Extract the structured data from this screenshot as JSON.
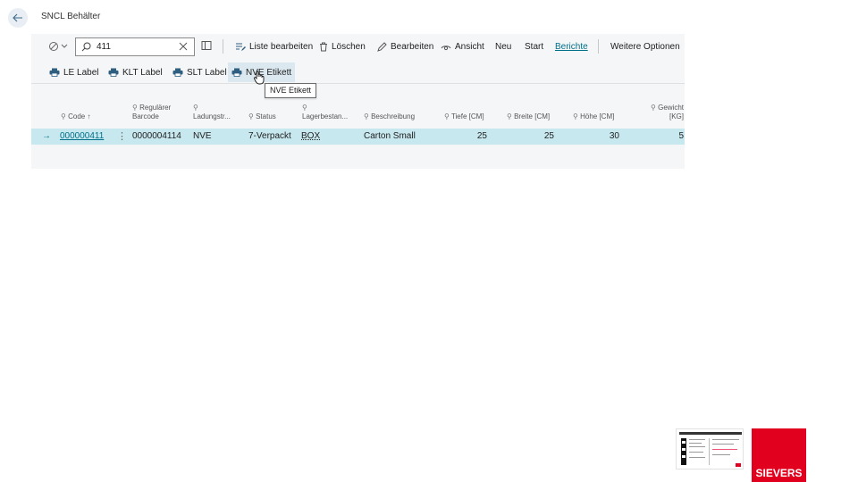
{
  "header": {
    "title": "SNCL Behälter"
  },
  "search": {
    "value": "411",
    "placeholder": ""
  },
  "actions": {
    "liste_bearbeiten": "Liste bearbeiten",
    "loeschen": "Löschen",
    "bearbeiten": "Bearbeiten",
    "ansicht": "Ansicht",
    "neu": "Neu",
    "start": "Start",
    "berichte": "Berichte",
    "weitere_optionen": "Weitere Optionen"
  },
  "reports": {
    "le_label": "LE Label",
    "klt_label": "KLT Label",
    "slt_label": "SLT Label",
    "nve_etikett": "NVE Etikett"
  },
  "tooltip": {
    "text": "NVE Etikett"
  },
  "columns": {
    "code": "Code ↑",
    "regulaerer_1": "Regulärer",
    "regulaerer_2": "Barcode",
    "ladungstraeger": "Ladungstr...",
    "status": "Status",
    "lagerbestand": "Lagerbestan...",
    "beschreibung": "Beschreibung",
    "tiefe": "Tiefe [CM]",
    "breite": "Breite [CM]",
    "hoehe": "Höhe [CM]",
    "gewicht_1": "Gewicht",
    "gewicht_2": "[KG]"
  },
  "rows": [
    {
      "code": "000000411",
      "barcode": "0000004114",
      "ladungstraeger": "NVE",
      "status": "7-Verpackt",
      "lagerbestand": "BOX",
      "beschreibung": "Carton Small",
      "tiefe": "25",
      "breite": "25",
      "hoehe": "30",
      "gewicht": "5"
    }
  ],
  "brand": {
    "logo_text": "SIEVERS",
    "color": "#e1001e",
    "accent": "#00708a"
  },
  "icons": {
    "back": "arrow-left-icon",
    "filter": "filter-icon",
    "search": "search-icon",
    "clear": "close-icon",
    "panel": "panel-toggle-icon",
    "edit_list": "edit-list-icon",
    "delete": "trash-icon",
    "edit": "pencil-icon",
    "view": "eye-icon",
    "print": "printer-icon"
  }
}
